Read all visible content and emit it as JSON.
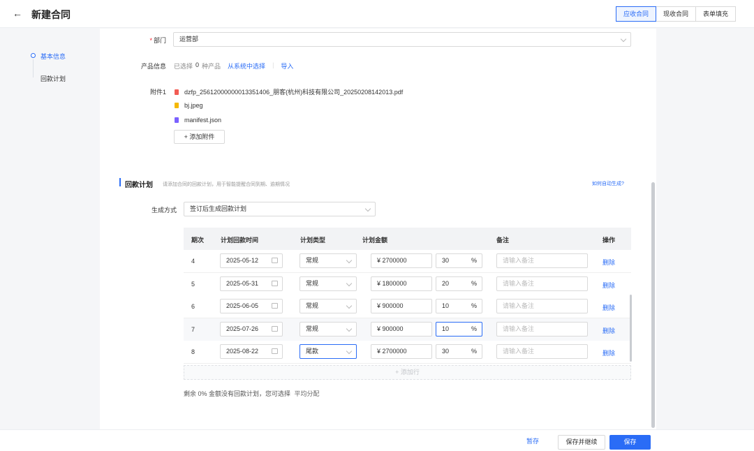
{
  "header": {
    "title": "新建合同",
    "tabs": [
      {
        "label": "应收合同",
        "active": true
      },
      {
        "label": "现收合同",
        "active": false
      },
      {
        "label": "表单填充",
        "active": false
      }
    ]
  },
  "sidebar": {
    "items": [
      {
        "label": "基本信息",
        "active": true
      },
      {
        "label": "回款计划",
        "active": false
      }
    ]
  },
  "form": {
    "department": {
      "label": "部门",
      "value": "运营部"
    },
    "product": {
      "label": "产品信息",
      "selected_prefix": "已选择",
      "count": "0",
      "selected_suffix": "种产品",
      "choose_link": "从系统中选择",
      "import_link": "导入"
    },
    "attachments": {
      "label": "附件1",
      "files": [
        {
          "name": "dzfp_25612000000013351406_朋客(杭州)科技有限公司_20250208142013.pdf",
          "color": "#f25c54"
        },
        {
          "name": "bj.jpeg",
          "color": "#f5b800"
        },
        {
          "name": "manifest.json",
          "color": "#7b61ff"
        }
      ],
      "add_button": "+ 添加附件"
    }
  },
  "plan": {
    "title": "回款计划",
    "subtitle": "请添加合同的回款计划，用于智能提醒合同到期、逾期情况",
    "help_link": "如何自动生成?",
    "mode_label": "生成方式",
    "mode_value": "签订后生成回款计划",
    "columns": [
      "期次",
      "计划回款时间",
      "计划类型",
      "计划金额",
      "备注",
      "操作"
    ],
    "rows": [
      {
        "period": "4",
        "date": "2025-05-12",
        "type": "常规",
        "amount": "¥ 2700000",
        "percent": "30",
        "remark_placeholder": "请输入备注",
        "action": "删除"
      },
      {
        "period": "5",
        "date": "2025-05-31",
        "type": "常规",
        "amount": "¥ 1800000",
        "percent": "20",
        "remark_placeholder": "请输入备注",
        "action": "删除"
      },
      {
        "period": "6",
        "date": "2025-06-05",
        "type": "常规",
        "amount": "¥ 900000",
        "percent": "10",
        "remark_placeholder": "请输入备注",
        "action": "删除"
      },
      {
        "period": "7",
        "date": "2025-07-26",
        "type": "常规",
        "amount": "¥ 900000",
        "percent": "10",
        "remark_placeholder": "请输入备注",
        "action": "删除"
      },
      {
        "period": "8",
        "date": "2025-08-22",
        "type": "尾款",
        "amount": "¥ 2700000",
        "percent": "30",
        "remark_placeholder": "请输入备注",
        "action": "删除"
      }
    ],
    "percent_unit": "%",
    "add_row": "+ 添加行",
    "remain_text": "剩余 0% 金额没有回款计划，您可选择",
    "remain_link": "平均分配"
  },
  "footer": {
    "draft": "暂存",
    "save_continue": "保存并继续",
    "save": "保存"
  },
  "colors": {
    "accent": "#2a6cf6",
    "required": "#f5222d"
  }
}
